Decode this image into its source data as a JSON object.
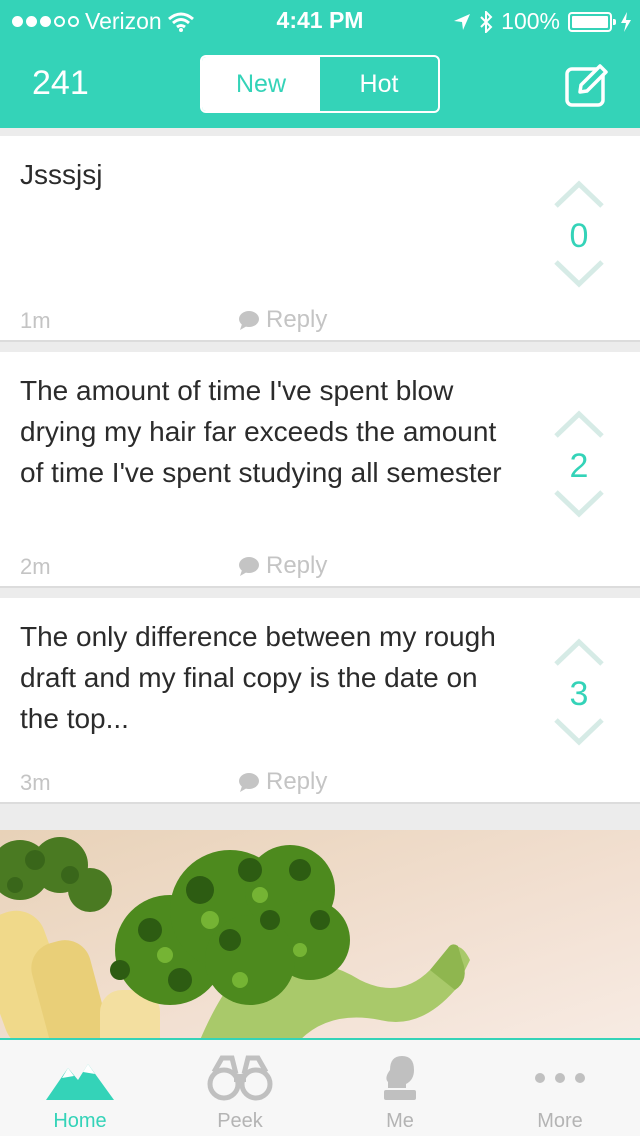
{
  "status_bar": {
    "carrier": "Verizon",
    "time": "4:41 PM",
    "battery": "100%",
    "signal_bars_filled": 3,
    "signal_bars_total": 5
  },
  "header": {
    "count": "241",
    "tabs": [
      {
        "label": "New",
        "active": true
      },
      {
        "label": "Hot",
        "active": false
      }
    ],
    "compose_icon": "compose-icon"
  },
  "posts": [
    {
      "text": "Jsssjsj",
      "time": "1m",
      "reply_label": "Reply",
      "votes": "0"
    },
    {
      "text": "The amount of time I've spent blow drying my hair far exceeds the amount of time I've spent studying all semester",
      "time": "2m",
      "reply_label": "Reply",
      "votes": "2"
    },
    {
      "text": "The only difference between my rough draft and my final copy is the date on the top...",
      "time": "3m",
      "reply_label": "Reply",
      "votes": "3"
    }
  ],
  "tab_bar": {
    "items": [
      {
        "label": "Home",
        "icon": "mountain-icon",
        "active": true
      },
      {
        "label": "Peek",
        "icon": "binoculars-icon",
        "active": false
      },
      {
        "label": "Me",
        "icon": "person-icon",
        "active": false
      },
      {
        "label": "More",
        "icon": "more-dots-icon",
        "active": false
      }
    ]
  },
  "colors": {
    "accent": "#34d3b8",
    "muted": "#c4c4c4",
    "vote_arrow": "#d6ebe6"
  }
}
